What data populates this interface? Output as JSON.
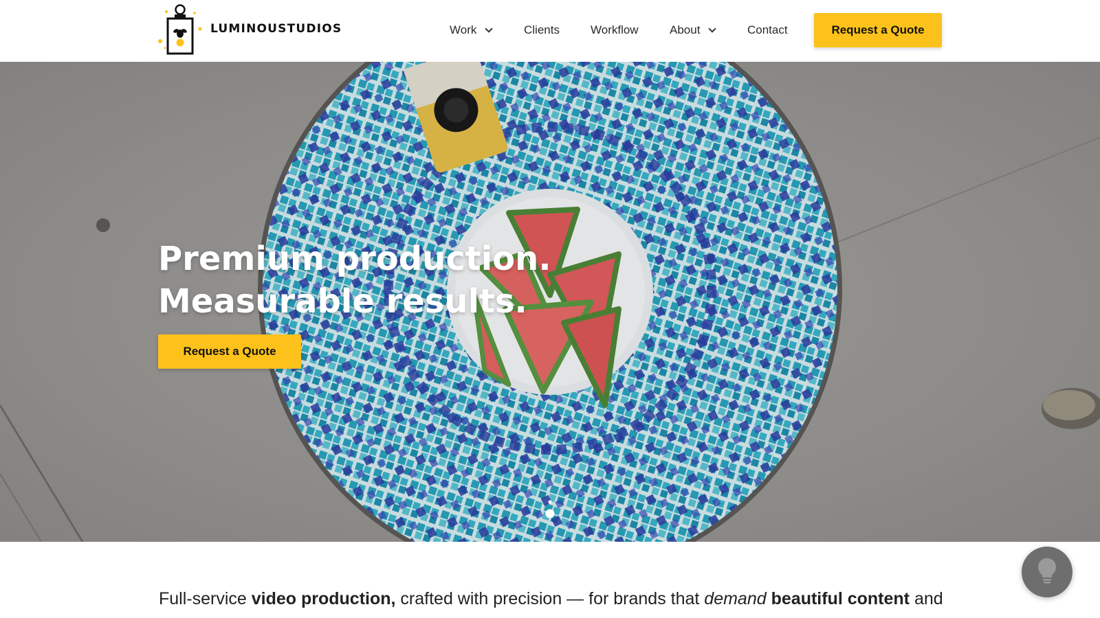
{
  "brand": {
    "name": "LUMINOUSTUDIOS"
  },
  "nav": {
    "items": [
      {
        "label": "Work",
        "has_dropdown": true
      },
      {
        "label": "Clients",
        "has_dropdown": false
      },
      {
        "label": "Workflow",
        "has_dropdown": false
      },
      {
        "label": "About",
        "has_dropdown": true
      },
      {
        "label": "Contact",
        "has_dropdown": false
      }
    ],
    "cta_label": "Request a Quote"
  },
  "hero": {
    "title_line1": "Premium production.",
    "title_line2": "Measurable results.",
    "cta_label": "Request a Quote"
  },
  "intro": {
    "part1": "Full-service ",
    "bold1": "video production,",
    "part2": " crafted with precision — for brands that ",
    "italic1": "demand",
    "part3": " ",
    "bold2": "beautiful content",
    "part4": " and"
  },
  "colors": {
    "accent": "#fcc21b",
    "text": "#222222",
    "assist_button": "#6e6e6e"
  },
  "icons": {
    "logo": "lantern-bee-icon",
    "dropdown": "chevron-down-icon",
    "scroll": "scroll-mouse-icon",
    "assist": "lightbulb-icon"
  }
}
